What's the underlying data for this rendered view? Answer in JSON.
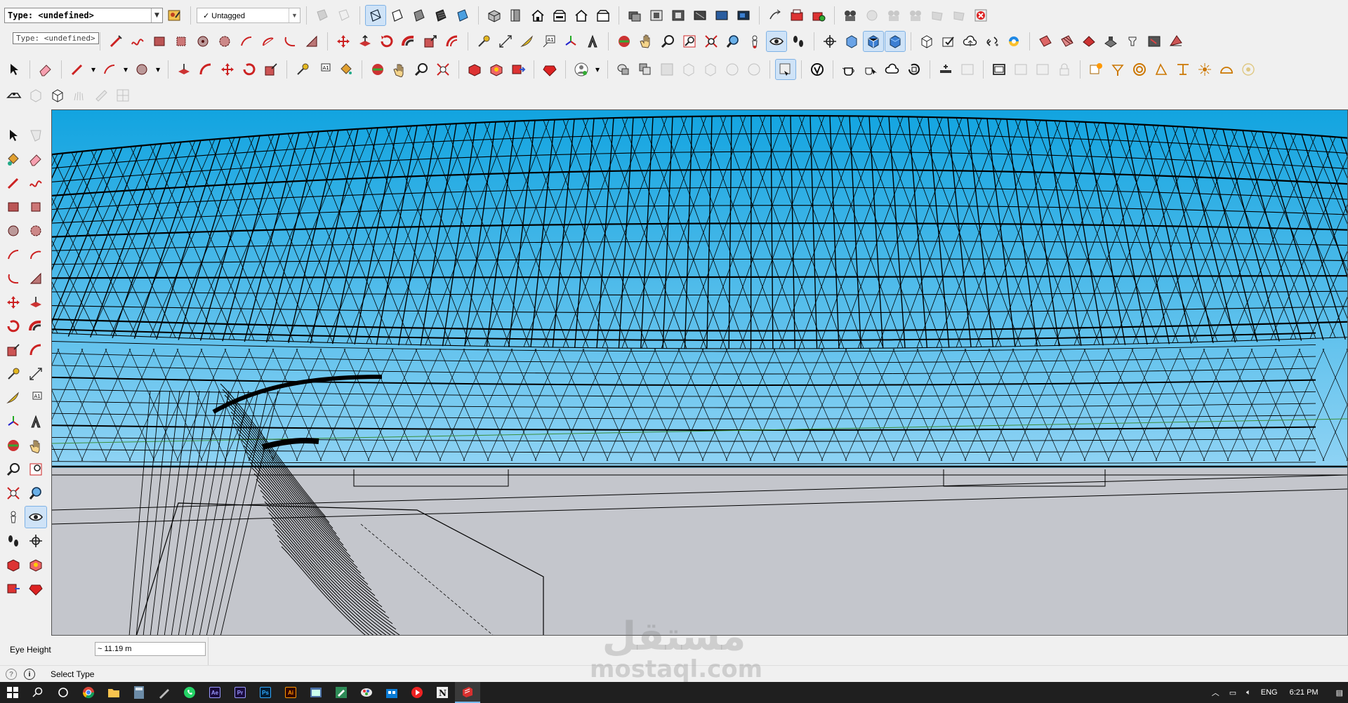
{
  "toolbar": {
    "type_select": "Type: <undefined>",
    "tag_select": "Untagged",
    "tag_check": "✓"
  },
  "tooltip": "Type: <undefined>",
  "measurements": {
    "label": "Eye Height",
    "value": "~ 11.19 m"
  },
  "status_bar": {
    "message": "Select Type"
  },
  "watermark": {
    "line1": "مستقل",
    "line2": "mostaql.com"
  },
  "taskbar": {
    "language": "ENG",
    "time": "6:21 PM",
    "apps": [
      {
        "name": "Ae",
        "color": "#9999ff",
        "bg": "#1a0a3c"
      },
      {
        "name": "Pr",
        "color": "#9999ff",
        "bg": "#1a0a3c"
      },
      {
        "name": "Ps",
        "color": "#31a8ff",
        "bg": "#001e36"
      },
      {
        "name": "Ai",
        "color": "#ff9a00",
        "bg": "#330000"
      }
    ]
  },
  "colors": {
    "sky_top": "#12a4e0",
    "sky_bottom": "#8fd3f4",
    "ground": "#c4c6cc",
    "accent": "#cfe3f7"
  }
}
